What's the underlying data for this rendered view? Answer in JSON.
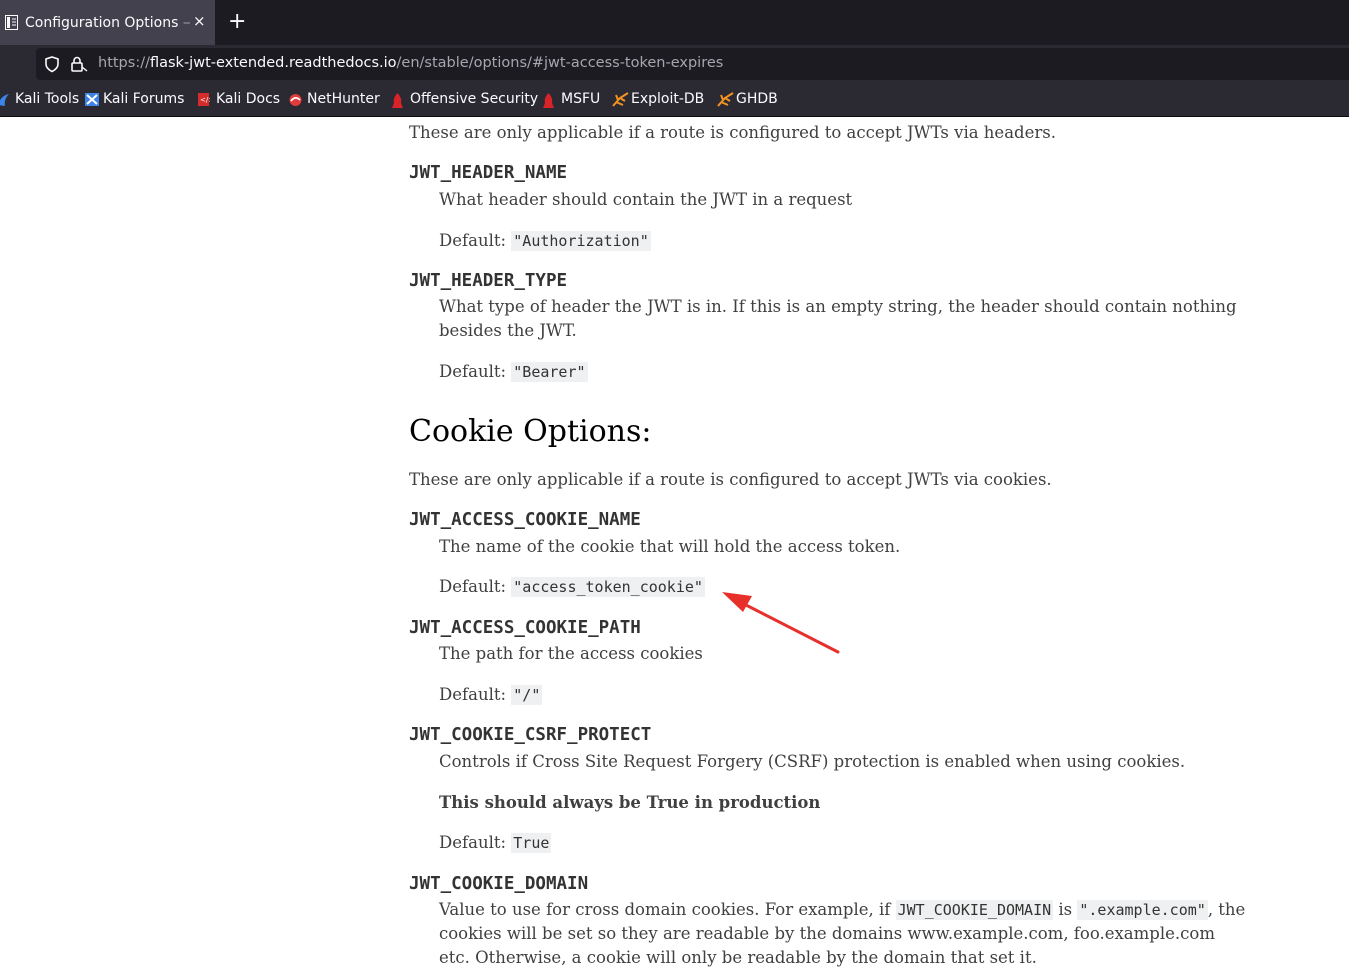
{
  "browser": {
    "tab": {
      "title": "Configuration Options",
      "title_suffix": " —",
      "close_glyph": "×"
    },
    "new_tab_glyph": "+",
    "url": {
      "scheme": "https://",
      "host": "flask-jwt-extended.readthedocs.io",
      "path": "/en/stable/options/#jwt-access-token-expires"
    },
    "bookmarks": [
      {
        "label": "Kali Tools",
        "icon": "kali-dragon-icon"
      },
      {
        "label": "Kali Forums",
        "icon": "kali-forums-icon"
      },
      {
        "label": "Kali Docs",
        "icon": "kali-docs-icon"
      },
      {
        "label": "NetHunter",
        "icon": "nethunter-icon"
      },
      {
        "label": "Offensive Security",
        "icon": "offsec-icon"
      },
      {
        "label": "MSFU",
        "icon": "msfu-icon"
      },
      {
        "label": "Exploit-DB",
        "icon": "exploit-db-icon"
      },
      {
        "label": "GHDB",
        "icon": "ghdb-icon"
      }
    ]
  },
  "page": {
    "header_intro": "These are only applicable if a route is configured to accept JWTs via headers.",
    "header_name": {
      "name": "JWT_HEADER_NAME",
      "desc": "What header should contain the JWT in a request",
      "default_label": "Default:",
      "default_value": "\"Authorization\""
    },
    "header_type": {
      "name": "JWT_HEADER_TYPE",
      "desc_line1": "What type of header the JWT is in. If this is an empty string, the header should contain nothing",
      "desc_line2": "besides the JWT.",
      "default_label": "Default:",
      "default_value": "\"Bearer\""
    },
    "cookie_heading": "Cookie Options:",
    "cookie_intro": "These are only applicable if a route is configured to accept JWTs via cookies.",
    "access_cookie_name": {
      "name": "JWT_ACCESS_COOKIE_NAME",
      "desc": "The name of the cookie that will hold the access token.",
      "default_label": "Default:",
      "default_value": "\"access_token_cookie\""
    },
    "access_cookie_path": {
      "name": "JWT_ACCESS_COOKIE_PATH",
      "desc": "The path for the access cookies",
      "default_label": "Default:",
      "default_value": "\"/\""
    },
    "csrf_protect": {
      "name": "JWT_COOKIE_CSRF_PROTECT",
      "desc": "Controls if Cross Site Request Forgery (CSRF) protection is enabled when using cookies.",
      "note": "This should always be True in production",
      "default_label": "Default:",
      "default_value": "True"
    },
    "cookie_domain": {
      "name": "JWT_COOKIE_DOMAIN",
      "desc_pre": "Value to use for cross domain cookies. For example, if ",
      "desc_code1": "JWT_COOKIE_DOMAIN",
      "desc_mid": " is ",
      "desc_code2": "\".example.com\"",
      "desc_post": ", the",
      "desc_line2": "cookies will be set so they are readable by the domains www.example.com, foo.example.com",
      "desc_line3": "etc. Otherwise, a cookie will only be readable by the domain that set it."
    }
  },
  "annotation": {
    "arrow_color": "#e8302b"
  }
}
